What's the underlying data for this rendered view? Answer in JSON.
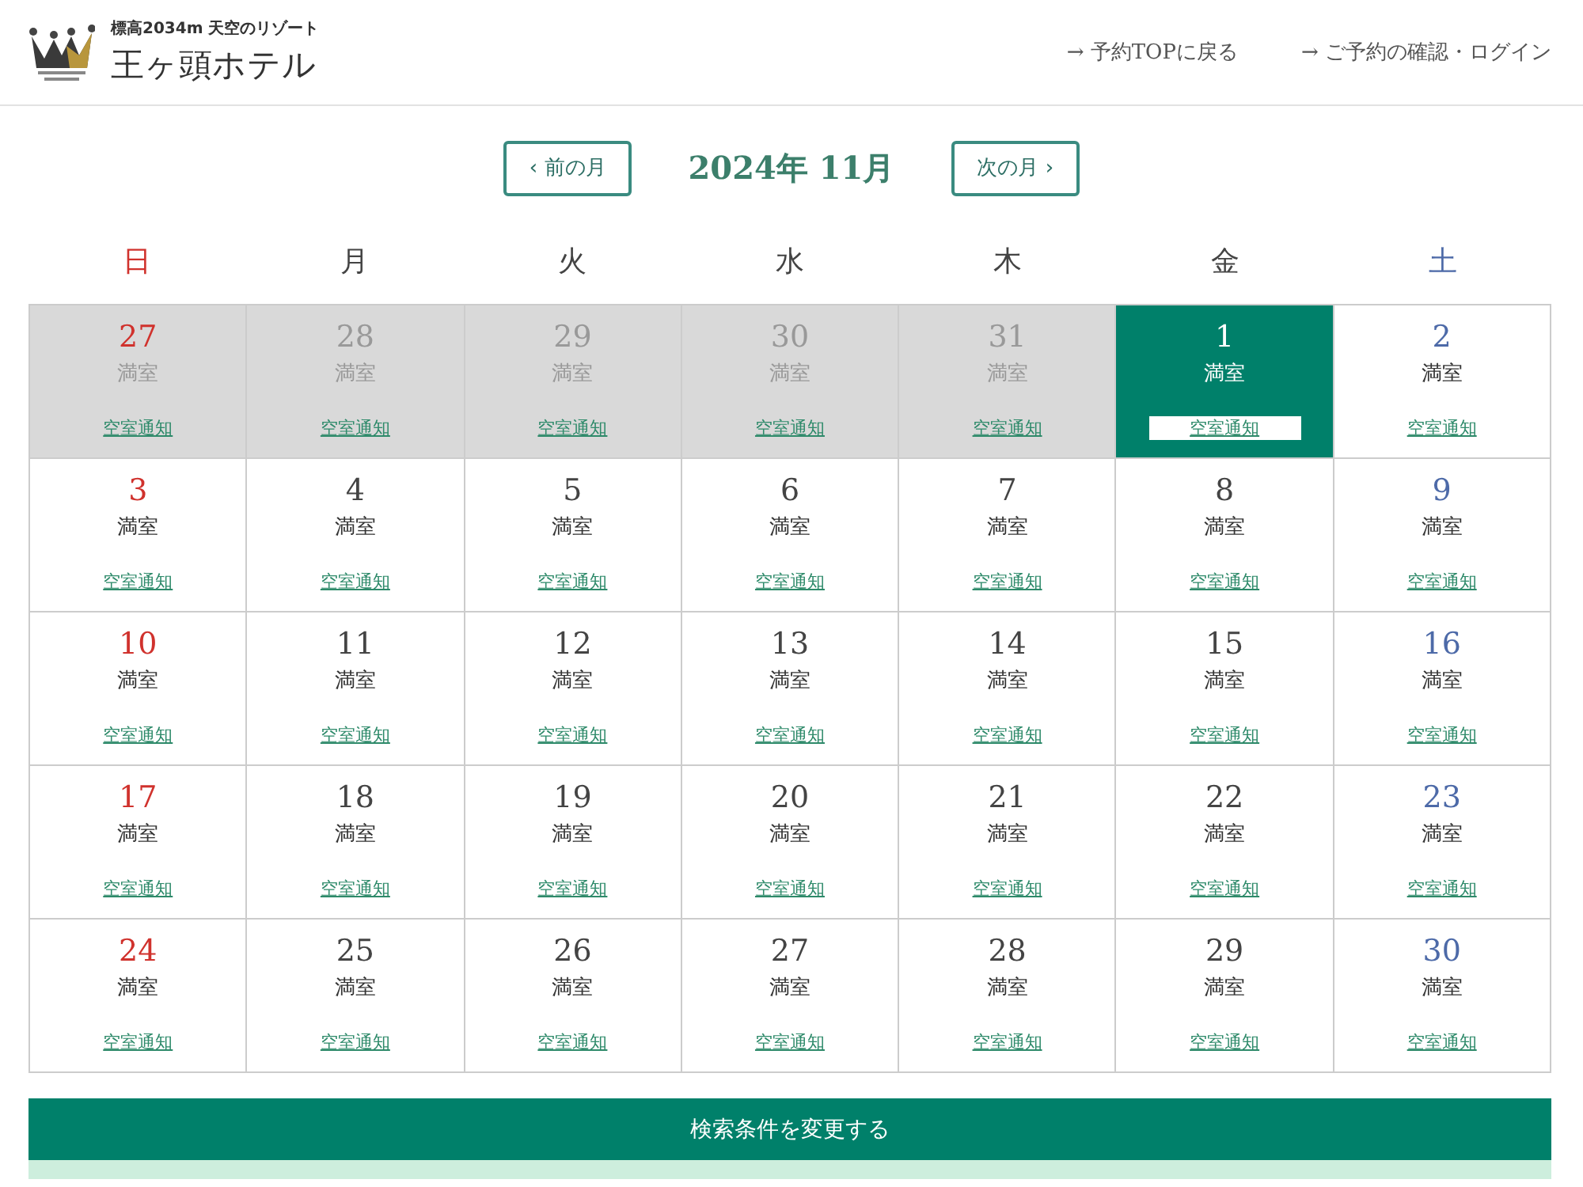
{
  "header": {
    "tagline": "標高2034m 天空のリゾート",
    "hotel_name": "王ヶ頭ホテル",
    "links": [
      {
        "arrow": "→",
        "label": "予約TOPに戻る"
      },
      {
        "arrow": "→",
        "label": "ご予約の確認・ログイン"
      }
    ]
  },
  "month_nav": {
    "prev": {
      "arrow": "‹",
      "label": "前の月"
    },
    "title": "2024年 11月",
    "next": {
      "label": "次の月",
      "arrow": "›"
    }
  },
  "weekdays": [
    "日",
    "月",
    "火",
    "水",
    "木",
    "金",
    "土"
  ],
  "weeks": [
    [
      {
        "day": "27",
        "status": "満室",
        "link": "空室通知",
        "outside": true,
        "selected": false
      },
      {
        "day": "28",
        "status": "満室",
        "link": "空室通知",
        "outside": true,
        "selected": false
      },
      {
        "day": "29",
        "status": "満室",
        "link": "空室通知",
        "outside": true,
        "selected": false
      },
      {
        "day": "30",
        "status": "満室",
        "link": "空室通知",
        "outside": true,
        "selected": false
      },
      {
        "day": "31",
        "status": "満室",
        "link": "空室通知",
        "outside": true,
        "selected": false
      },
      {
        "day": "1",
        "status": "満室",
        "link": "空室通知",
        "selected": true
      },
      {
        "day": "2",
        "status": "満室",
        "link": "空室通知",
        "outside": false,
        "selected": false
      }
    ],
    [
      {
        "day": "3",
        "status": "満室",
        "link": "空室通知",
        "outside": false,
        "selected": false
      },
      {
        "day": "4",
        "status": "満室",
        "link": "空室通知",
        "outside": false,
        "selected": false
      },
      {
        "day": "5",
        "status": "満室",
        "link": "空室通知",
        "outside": false,
        "selected": false
      },
      {
        "day": "6",
        "status": "満室",
        "link": "空室通知",
        "outside": false,
        "selected": false
      },
      {
        "day": "7",
        "status": "満室",
        "link": "空室通知",
        "outside": false,
        "selected": false
      },
      {
        "day": "8",
        "status": "満室",
        "link": "空室通知",
        "outside": false,
        "selected": false
      },
      {
        "day": "9",
        "status": "満室",
        "link": "空室通知",
        "outside": false,
        "selected": false
      }
    ],
    [
      {
        "day": "10",
        "status": "満室",
        "link": "空室通知",
        "outside": false,
        "selected": false
      },
      {
        "day": "11",
        "status": "満室",
        "link": "空室通知",
        "outside": false,
        "selected": false
      },
      {
        "day": "12",
        "status": "満室",
        "link": "空室通知",
        "outside": false,
        "selected": false
      },
      {
        "day": "13",
        "status": "満室",
        "link": "空室通知",
        "outside": false,
        "selected": false
      },
      {
        "day": "14",
        "status": "満室",
        "link": "空室通知",
        "outside": false,
        "selected": false
      },
      {
        "day": "15",
        "status": "満室",
        "link": "空室通知",
        "outside": false,
        "selected": false
      },
      {
        "day": "16",
        "status": "満室",
        "link": "空室通知",
        "outside": false,
        "selected": false
      }
    ],
    [
      {
        "day": "17",
        "status": "満室",
        "link": "空室通知",
        "outside": false,
        "selected": false
      },
      {
        "day": "18",
        "status": "満室",
        "link": "空室通知",
        "outside": false,
        "selected": false
      },
      {
        "day": "19",
        "status": "満室",
        "link": "空室通知",
        "outside": false,
        "selected": false
      },
      {
        "day": "20",
        "status": "満室",
        "link": "空室通知",
        "outside": false,
        "selected": false
      },
      {
        "day": "21",
        "status": "満室",
        "link": "空室通知",
        "outside": false,
        "selected": false
      },
      {
        "day": "22",
        "status": "満室",
        "link": "空室通知",
        "outside": false,
        "selected": false
      },
      {
        "day": "23",
        "status": "満室",
        "link": "空室通知",
        "outside": false,
        "selected": false
      }
    ],
    [
      {
        "day": "24",
        "status": "満室",
        "link": "空室通知",
        "outside": false,
        "selected": false
      },
      {
        "day": "25",
        "status": "満室",
        "link": "空室通知",
        "outside": false,
        "selected": false
      },
      {
        "day": "26",
        "status": "満室",
        "link": "空室通知",
        "outside": false,
        "selected": false
      },
      {
        "day": "27",
        "status": "満室",
        "link": "空室通知",
        "outside": false,
        "selected": false
      },
      {
        "day": "28",
        "status": "満室",
        "link": "空室通知",
        "outside": false,
        "selected": false
      },
      {
        "day": "29",
        "status": "満室",
        "link": "空室通知",
        "outside": false,
        "selected": false
      },
      {
        "day": "30",
        "status": "満室",
        "link": "空室通知",
        "outside": false,
        "selected": false
      }
    ]
  ],
  "search_button": "検索条件を変更する"
}
